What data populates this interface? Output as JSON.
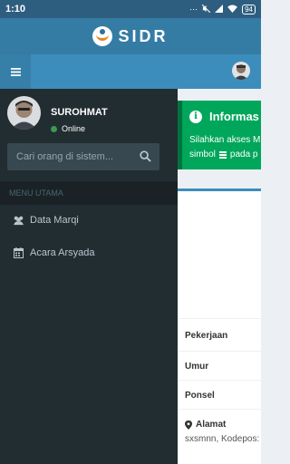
{
  "statusbar": {
    "time": "1:10",
    "battery": "94",
    "icons": [
      "dots-icon",
      "mute-icon",
      "signal-icon",
      "wifi-icon",
      "battery-icon"
    ]
  },
  "app": {
    "title": "SIDR"
  },
  "navbar": {
    "toggle_icon": "hamburger-icon"
  },
  "user": {
    "name": "SUROHMAT",
    "status": "Online"
  },
  "search": {
    "placeholder": "Cari orang di sistem..."
  },
  "menu": {
    "header": "MENU UTAMA",
    "items": [
      {
        "label": "Data Marqi",
        "icon": "users-icon"
      },
      {
        "label": "Acara Arsyada",
        "icon": "calendar-icon"
      }
    ]
  },
  "callout": {
    "title": "Informas",
    "line1": "Silahkan akses M",
    "line2a": "simbol",
    "line2b": "pada p"
  },
  "profile": {
    "rows": [
      "Pekerjaan",
      "Umur",
      "Ponsel"
    ],
    "alamat_label": "Alamat",
    "alamat_value": "sxsmnn, Kodepos:"
  },
  "colors": {
    "header": "#357ca5",
    "navbar": "#3c8dbc",
    "sidebar": "#222d32",
    "callout": "#00a65a"
  }
}
